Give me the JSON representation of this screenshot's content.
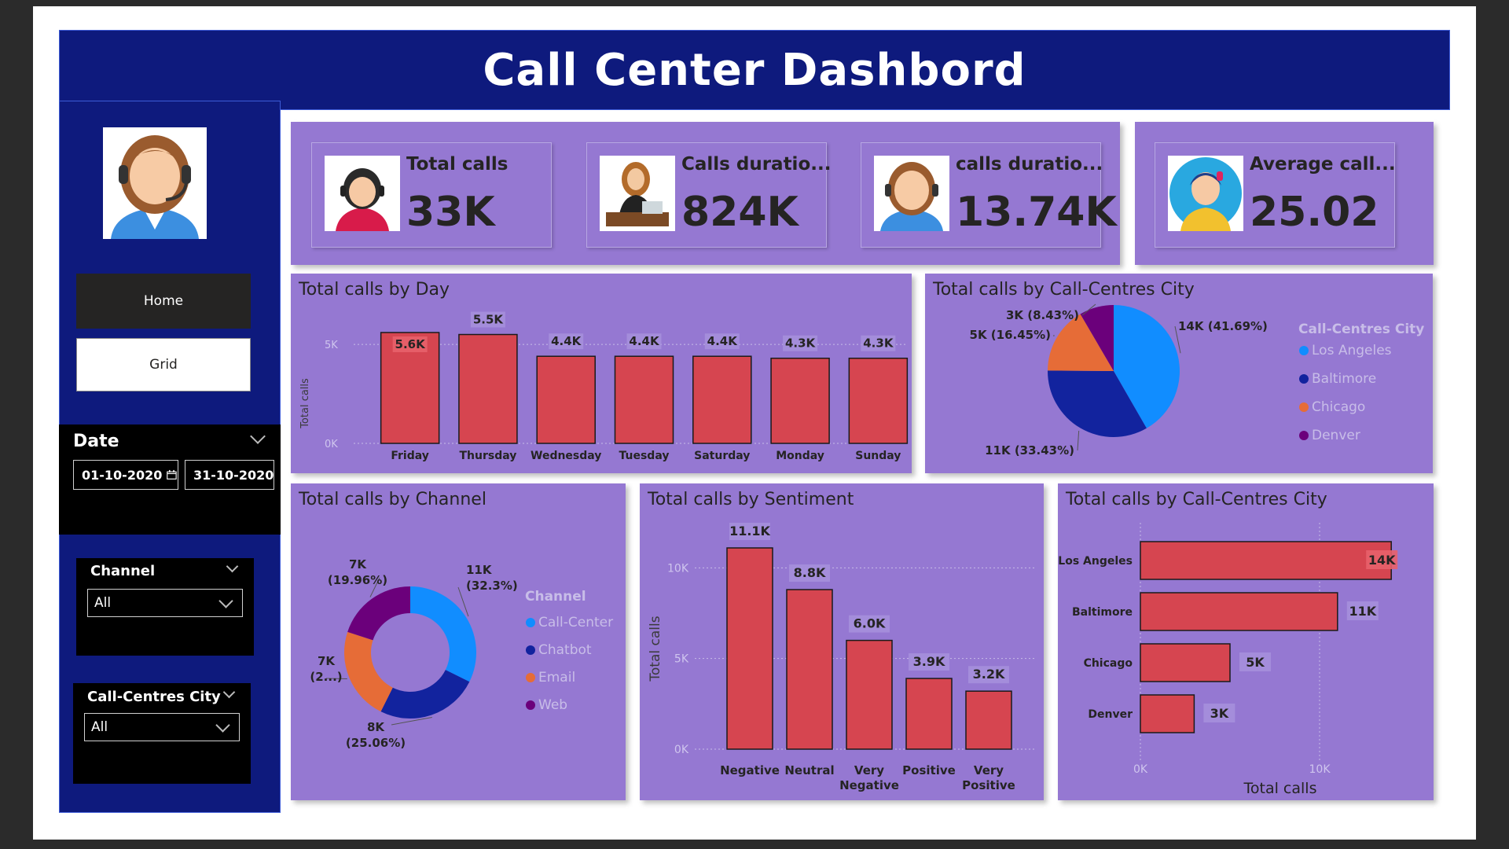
{
  "header": {
    "title": "Call Center Dashbord"
  },
  "nav": {
    "home_label": "Home",
    "grid_label": "Grid"
  },
  "date_slicer": {
    "title": "Date",
    "start": "01-10-2020",
    "end": "31-10-2020"
  },
  "channel_slicer": {
    "title": "Channel",
    "value": "All"
  },
  "city_slicer": {
    "title": "Call-Centres City",
    "value": "All"
  },
  "kpis": [
    {
      "label": "Total calls",
      "value": "33K"
    },
    {
      "label": "Calls duratio...",
      "value": "824K"
    },
    {
      "label": "calls duratio...",
      "value": "13.74K"
    },
    {
      "label": "Average call...",
      "value": "25.02"
    }
  ],
  "colors": {
    "bar": "#d64550",
    "los_angeles": "#118dff",
    "baltimore": "#12239e",
    "chicago": "#e66c37",
    "denver": "#6b007b",
    "panel": "#9578d2",
    "header": "#0e1a7d"
  },
  "chart_data": [
    {
      "type": "bar",
      "title": "Total calls by Day",
      "ylabel": "Total calls",
      "categories": [
        "Friday",
        "Thursday",
        "Wednesday",
        "Tuesday",
        "Saturday",
        "Monday",
        "Sunday"
      ],
      "values": [
        5600,
        5500,
        4400,
        4400,
        4400,
        4300,
        4300
      ],
      "labels": [
        "5.6K",
        "5.5K",
        "4.4K",
        "4.4K",
        "4.4K",
        "4.3K",
        "4.3K"
      ],
      "yticks": [
        "0K",
        "5K"
      ],
      "ylim": [
        0,
        5600
      ]
    },
    {
      "type": "pie",
      "title": "Total calls by Call-Centres City",
      "legend_title": "Call-Centres City",
      "slices": [
        {
          "name": "Los Angeles",
          "value": 41.69,
          "label": "14K (41.69%)"
        },
        {
          "name": "Baltimore",
          "value": 33.43,
          "label": "11K (33.43%)"
        },
        {
          "name": "Chicago",
          "value": 16.45,
          "label": "5K (16.45%)"
        },
        {
          "name": "Denver",
          "value": 8.43,
          "label": "3K (8.43%)"
        }
      ]
    },
    {
      "type": "pie",
      "title": "Total calls by Channel",
      "legend_title": "Channel",
      "slices": [
        {
          "name": "Call-Center",
          "value": 32.3,
          "label": [
            "11K",
            "(32.3%)"
          ]
        },
        {
          "name": "Chatbot",
          "value": 25.06,
          "label": [
            "8K",
            "(25.06%)"
          ]
        },
        {
          "name": "Email",
          "value": 22.68,
          "label": [
            "7K",
            "(2...)"
          ]
        },
        {
          "name": "Web",
          "value": 19.96,
          "label": [
            "7K",
            "(19.96%)"
          ]
        }
      ]
    },
    {
      "type": "bar",
      "title": "Total calls by Sentiment",
      "ylabel": "Total calls",
      "categories": [
        "Negative",
        "Neutral",
        "Very Negative",
        "Positive",
        "Very Positive"
      ],
      "values": [
        11100,
        8800,
        6000,
        3900,
        3200
      ],
      "labels": [
        "11.1K",
        "8.8K",
        "6.0K",
        "3.9K",
        "3.2K"
      ],
      "yticks": [
        "0K",
        "5K",
        "10K"
      ],
      "ylim": [
        0,
        11100
      ]
    },
    {
      "type": "bar",
      "orientation": "horizontal",
      "title": "Total calls by Call-Centres City",
      "xlabel": "Total calls",
      "categories": [
        "Los Angeles",
        "Baltimore",
        "Chicago",
        "Denver"
      ],
      "values": [
        14000,
        11000,
        5000,
        3000
      ],
      "labels": [
        "14K",
        "11K",
        "5K",
        "3K"
      ],
      "xticks": [
        "0K",
        "10K"
      ],
      "xlim": [
        0,
        14000
      ]
    }
  ]
}
